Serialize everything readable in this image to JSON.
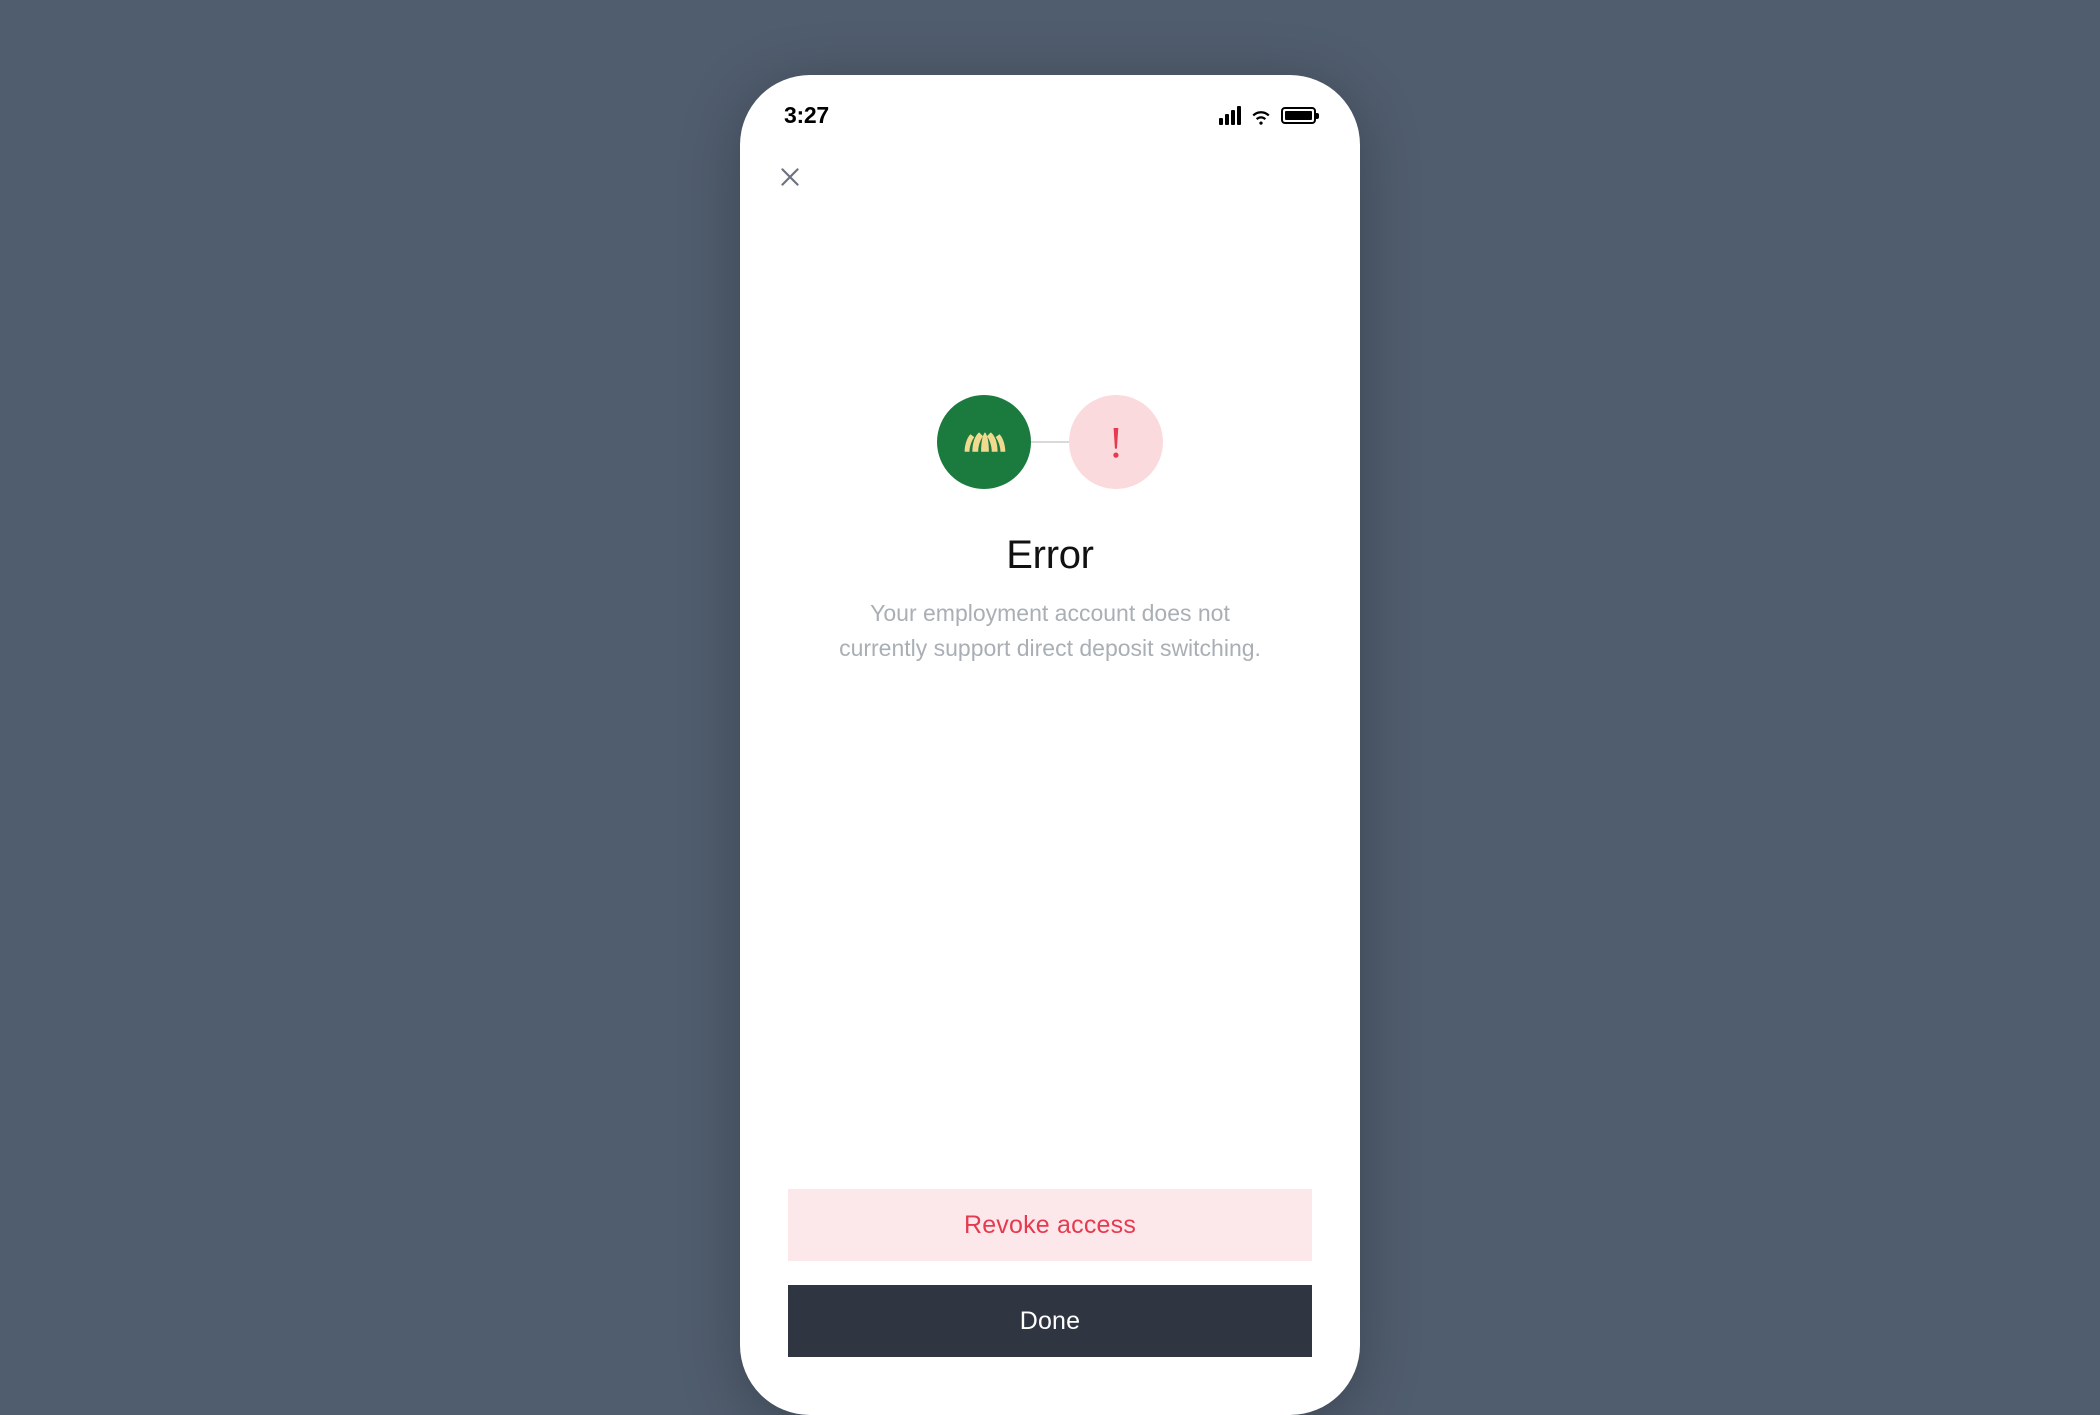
{
  "statusBar": {
    "time": "3:27"
  },
  "icons": {
    "brand": "croissant-icon",
    "error": "exclamation-icon"
  },
  "error": {
    "heading": "Error",
    "subtext": "Your employment account does not currently support direct deposit switching.",
    "exclaim": "!"
  },
  "buttons": {
    "revoke": "Revoke access",
    "done": "Done"
  },
  "colors": {
    "background": "#505d6e",
    "brandCircle": "#1b7b3f",
    "errorCircle": "#fbdadd",
    "errorAccent": "#e53a50",
    "primaryButton": "#2f3641"
  }
}
